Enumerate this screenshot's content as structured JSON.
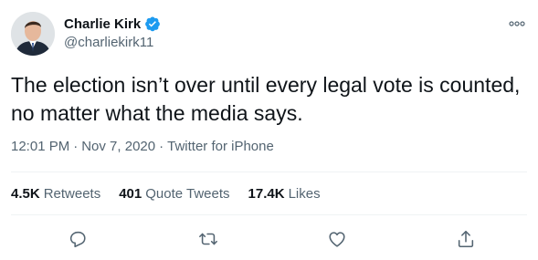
{
  "tweet": {
    "author": {
      "display_name": "Charlie Kirk",
      "handle": "@charliekirk11",
      "verified": true
    },
    "text": "The election isn’t over until every legal vote is counted, no matter what the media says.",
    "time": "12:01 PM",
    "date": "Nov 7, 2020",
    "source": "Twitter for iPhone",
    "separator": "·"
  },
  "stats": {
    "retweets": {
      "count": "4.5K",
      "label": "Retweets"
    },
    "quotes": {
      "count": "401",
      "label": "Quote Tweets"
    },
    "likes": {
      "count": "17.4K",
      "label": "Likes"
    }
  },
  "colors": {
    "primary_text": "#0f1419",
    "secondary_text": "#536471",
    "verified_blue": "#1d9bf0",
    "icon_gray": "#536471",
    "divider": "#eff3f4"
  },
  "icons": {
    "more": "more-options-icon",
    "reply": "reply-icon",
    "retweet": "retweet-icon",
    "like": "like-icon",
    "share": "share-icon"
  }
}
